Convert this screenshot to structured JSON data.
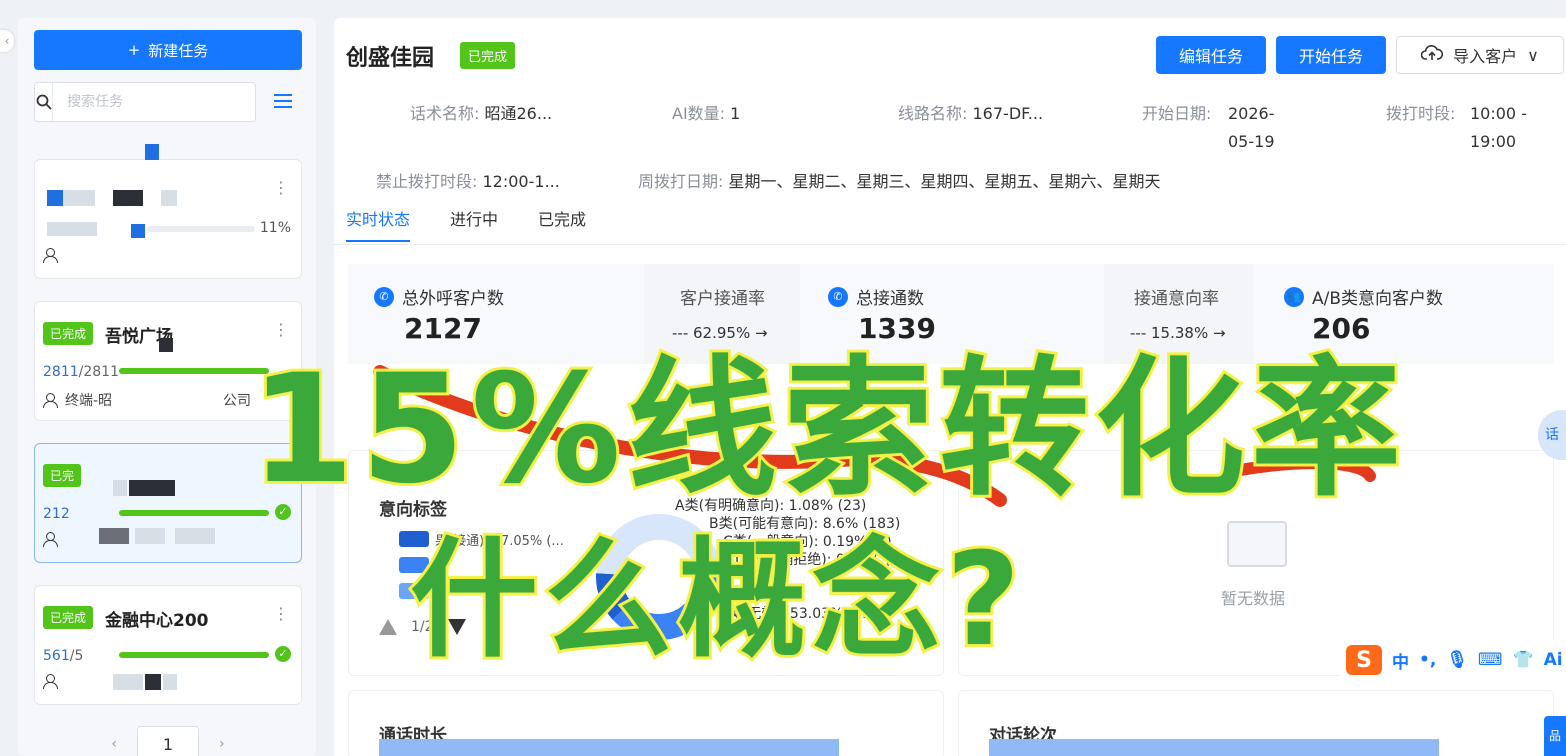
{
  "sidebar": {
    "collapse_icon": "chevron-left-icon",
    "new_task_label": "新建任务",
    "search_placeholder": "搜索任务",
    "cards": [
      {
        "pct": "11%"
      },
      {
        "badge": "已完成",
        "name": "吾悦广场",
        "done": "2811",
        "total": "2811",
        "owner": "终端-昭",
        "company": "公司"
      },
      {
        "badge": "已完",
        "done": "212"
      },
      {
        "badge": "已完成",
        "name": "金融中心200",
        "done": "561",
        "total": "5"
      }
    ],
    "page": "1"
  },
  "header": {
    "title": "创盛佳园",
    "badge": "已完成",
    "edit_btn": "编辑任务",
    "start_btn": "开始任务",
    "import_btn": "导入客户"
  },
  "meta": {
    "script_label": "话术名称:",
    "script_value": "昭通26...",
    "ai_label": "AI数量:",
    "ai_value": "1",
    "line_label": "线路名称:",
    "line_value": "167-DF...",
    "start_label": "开始日期:",
    "start_value_1": "2026-",
    "start_value_2": "05-19",
    "dial_label": "拨打时段:",
    "dial_value_1": "10:00 -",
    "dial_value_2": "19:00",
    "ban_label": "禁止拨打时段:",
    "ban_value": "12:00-1...",
    "week_label": "周拨打日期:",
    "week_value": "星期一、星期二、星期三、星期四、星期五、星期六、星期天"
  },
  "tabs": [
    "实时状态",
    "进行中",
    "已完成"
  ],
  "stats": {
    "total_call_label": "总外呼客户数",
    "total_call_value": "2127",
    "connect_rate_label": "客户接通率",
    "connect_rate_value": "62.95%",
    "total_connect_label": "总接通数",
    "total_connect_value": "1339",
    "intent_rate_label": "接通意向率",
    "intent_rate_value": "15.38%",
    "ab_label": "A/B类意向客户数",
    "ab_value": "206"
  },
  "intent_panel": {
    "title": "意向标签",
    "legend": [
      "果(接通): 37.05% (...",
      "C",
      "D"
    ],
    "pie_labels": {
      "a": "A类(有明确意向): 1.08% (23)",
      "b": "B类(可能有意向): 8.6% (183)",
      "c": "C类(一般意向): 0.19% (4)",
      "d": "D类(明确拒绝): 0.05% (1)",
      "e": "E类(无效): 53.03% (..."
    },
    "pager": "1/2",
    "colors": {
      "blue_dark": "#1f5fd0",
      "blue_mid": "#3b82f6",
      "blue_light": "#6aa6f8"
    }
  },
  "empty_panel": {
    "text": "暂无数据"
  },
  "bottom": {
    "duration_title": "通话时长",
    "rounds_title": "对话轮次"
  },
  "overlay": {
    "line1": "15%线索转化率",
    "line2": "什么概念?"
  },
  "ime": {
    "zh": "中",
    "s": "S",
    "ai": "Ai"
  },
  "side_tab": "话",
  "side_tab2": "品"
}
